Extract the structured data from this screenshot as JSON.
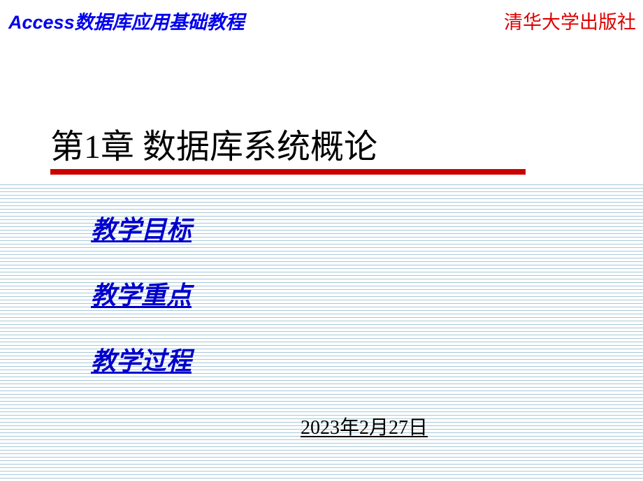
{
  "header": {
    "left": "Access数据库应用基础教程",
    "right": "清华大学出版社"
  },
  "chapter": {
    "title": "第1章  数据库系统概论"
  },
  "content": {
    "items": [
      "教学目标",
      "教学重点",
      "教学过程"
    ]
  },
  "date": "2023年2月27日"
}
